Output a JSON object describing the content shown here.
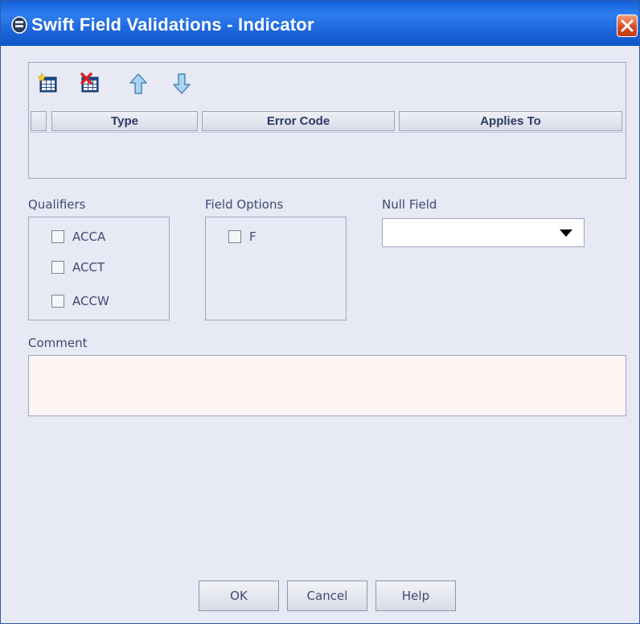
{
  "window": {
    "title": "Swift Field Validations - Indicator",
    "accent": "#1b63d9",
    "background": "#e7e9f4"
  },
  "toolbar": {
    "icons": [
      "add-row-icon",
      "delete-row-icon",
      "move-up-icon",
      "move-down-icon"
    ]
  },
  "grid": {
    "columns": [
      "Type",
      "Error Code",
      "Applies To"
    ],
    "rows": []
  },
  "qualifiers": {
    "label": "Qualifiers",
    "items": [
      {
        "label": "ACCA",
        "checked": false
      },
      {
        "label": "ACCT",
        "checked": false
      },
      {
        "label": "ACCW",
        "checked": false
      }
    ]
  },
  "field_options": {
    "label": "Field Options",
    "items": [
      {
        "label": "F",
        "checked": false
      }
    ]
  },
  "null_field": {
    "label": "Null Field",
    "value": ""
  },
  "comment": {
    "label": "Comment",
    "value": ""
  },
  "buttons": {
    "ok": "OK",
    "cancel": "Cancel",
    "help": "Help"
  }
}
